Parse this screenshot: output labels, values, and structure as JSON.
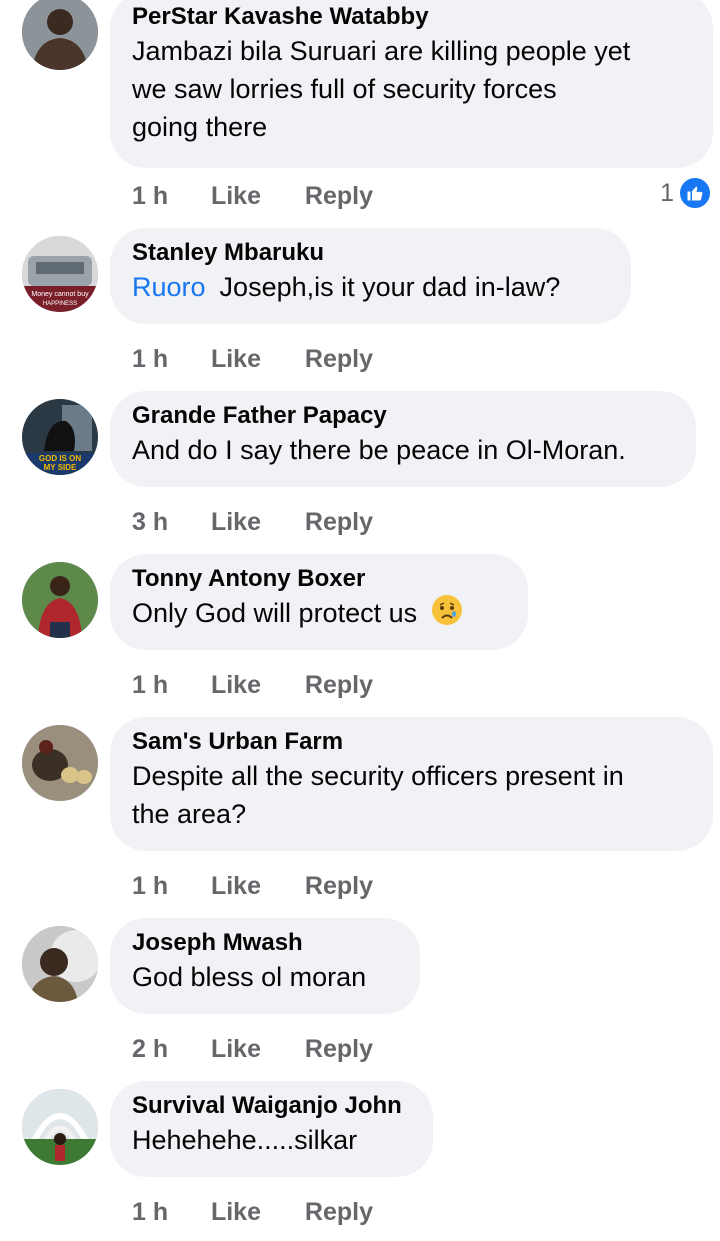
{
  "comments": [
    {
      "author": "PerStar Kavashe Watabby",
      "lines": [
        "Jambazi bila Suruari are killing people yet",
        "we saw lorries full of security forces",
        "going there"
      ],
      "time": "1 h",
      "like": "Like",
      "reply": "Reply",
      "reaction_count": "1"
    },
    {
      "author": "Stanley Mbaruku",
      "mention": "Ruoro",
      "text": "Joseph,is it your dad in-law?",
      "avatar_text": [
        "Money cannot buy",
        "HAPPINESS"
      ],
      "time": "1 h",
      "like": "Like",
      "reply": "Reply"
    },
    {
      "author": "Grande Father Papacy",
      "text": "And do I say there be peace in Ol-Moran.",
      "avatar_text": [
        "GOD IS ON",
        "MY SIDE"
      ],
      "time": "3 h",
      "like": "Like",
      "reply": "Reply"
    },
    {
      "author": "Tonny Antony Boxer",
      "text": "Only God will protect us",
      "emoji": "sad-face-emoji",
      "time": "1 h",
      "like": "Like",
      "reply": "Reply"
    },
    {
      "author": "Sam's Urban Farm",
      "lines": [
        "Despite all the security officers present in",
        "the area?"
      ],
      "time": "1 h",
      "like": "Like",
      "reply": "Reply"
    },
    {
      "author": "Joseph Mwash",
      "text": "God bless ol moran",
      "time": "2 h",
      "like": "Like",
      "reply": "Reply"
    },
    {
      "author": "Survival Waiganjo John",
      "text": "Hehehehe.....silkar",
      "time": "1 h",
      "like": "Like",
      "reply": "Reply"
    }
  ],
  "colors": {
    "bubble": "#f0f2f5",
    "text": "#050505",
    "meta": "#65676b",
    "link": "#1877f2"
  }
}
